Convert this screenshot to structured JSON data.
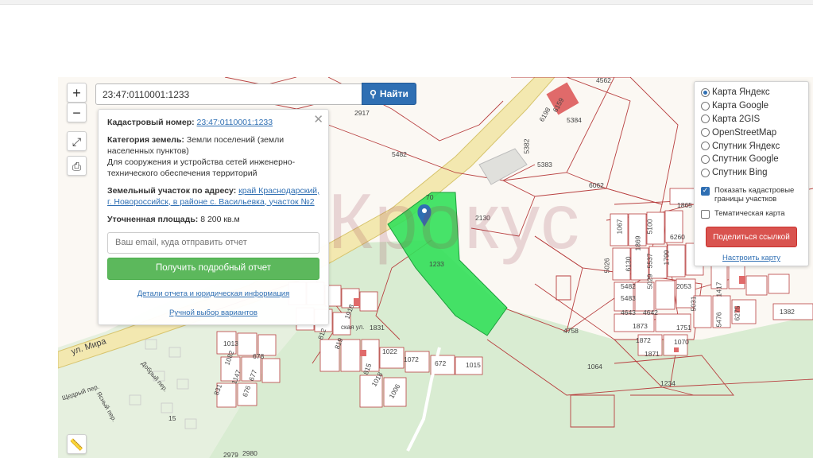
{
  "search": {
    "value": "23:47:0110001:1233",
    "button_label": "Найти"
  },
  "controls": {
    "zoom_in": "+",
    "zoom_out": "−"
  },
  "info": {
    "cadastral_label": "Кадастровый номер:",
    "cadastral_value": "23:47:0110001:1233",
    "category_label": "Категория земель:",
    "category_value": "Земли поселений (земли населенных пунктов)",
    "purpose": "Для сооружения и устройства сетей инженерно-технического обеспечения территорий",
    "address_label": "Земельный участок по адресу:",
    "address_value": "край Краснодарский, г. Новороссийск, в районе с. Васильевка, участок №2",
    "area_label": "Уточненная площадь:",
    "area_value": "8 200 кв.м",
    "email_placeholder": "Ваш email, куда отправить отчет",
    "report_button": "Получить подробный отчет",
    "details_link": "Детали отчета и юридическая информация",
    "manual_link": "Ручной выбор вариантов"
  },
  "layers": {
    "options": [
      "Карта Яндекс",
      "Карта Google",
      "Карта 2GIS",
      "OpenStreetMap",
      "Спутник Яндекс",
      "Спутник Google",
      "Спутник Bing"
    ],
    "selected": "Карта Яндекс",
    "show_borders": "Показать кадастровые границы участков",
    "thematic_map": "Тематическая карта",
    "share_button": "Поделиться ссылкой",
    "configure_link": "Настроить карту"
  },
  "watermark": "Крокус",
  "map_labels": {
    "street_mira": "ул. Мира",
    "street_shchedry": "Щедрый пер.",
    "street_yasny": "Ясный пер.",
    "street_dobry": "Добрый пер.",
    "street_partial": "ская ул.",
    "plot_4562": "4562",
    "plot_5384": "5384",
    "plot_5482": "5482",
    "plot_5382": "5382",
    "plot_5383": "5383",
    "plot_6062": "6062",
    "plot_70": "70",
    "plot_2130": "2130",
    "plot_1233": "1233",
    "plot_4758": "4758",
    "plot_1234": "1234",
    "plot_1064": "1064",
    "plot_1382": "1382",
    "plot_1865": "1865",
    "plot_6260": "6260",
    "plot_5100": "5100",
    "plot_1067": "1067",
    "plot_1869": "1869",
    "plot_5026": "5026",
    "plot_6130": "6130",
    "plot_5537": "5537",
    "plot_1799": "1799",
    "plot_5482b": "5482",
    "plot_5029": "5029",
    "plot_2053": "2053",
    "plot_5483": "5483",
    "plot_4643": "4643",
    "plot_4642": "4642",
    "plot_5031": "5031",
    "plot_1873": "1873",
    "plot_1872": "1872",
    "plot_1070": "1070",
    "plot_1871": "1871",
    "plot_1751": "1751",
    "plot_5476": "5476",
    "plot_6275": "6275",
    "plot_1417": "1417",
    "plot_1831": "1831",
    "plot_812": "812",
    "plot_819": "819",
    "plot_1022": "1022",
    "plot_1072": "1072",
    "plot_672": "672",
    "plot_1015": "1015",
    "plot_1018": "1018",
    "plot_1006": "1006",
    "plot_815": "815",
    "plot_1013": "1013",
    "plot_1082": "1082",
    "plot_678": "678",
    "plot_677": "677",
    "plot_676": "676",
    "plot_1147": "1147",
    "plot_831": "831",
    "plot_15": "15",
    "plot_2917": "2917",
    "plot_1918": "1918",
    "plot_2979": "2979",
    "plot_2980": "2980",
    "plot_6198": "6198",
    "plot_6159": "6159"
  },
  "colors": {
    "accent": "#2f6fb3",
    "success": "#5cb85c",
    "danger": "#d9534f",
    "plot": "#33e05a",
    "forest": "#d6ead0",
    "road": "#f1e6a8",
    "boundary": "#b84040"
  }
}
